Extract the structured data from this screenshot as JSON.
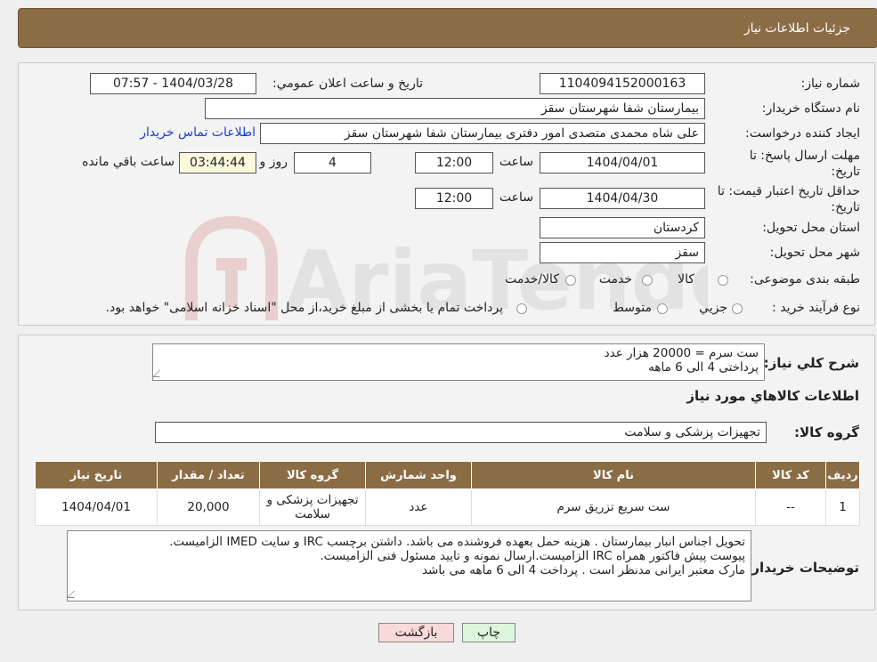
{
  "header": {
    "title": "جزئیات اطلاعات نیاز"
  },
  "form": {
    "need_number_label": "شماره نیاز:",
    "need_number": "1104094152000163",
    "announce_label": "تاریخ و ساعت اعلان عمومي:",
    "announce_value": "1404/03/28 - 07:57",
    "buyer_org_label": "نام دستگاه خريدار:",
    "buyer_org": "بیمارستان شفا شهرستان سقز",
    "creator_label": "ايجاد كننده درخواست:",
    "creator": "علی شاه محمدی متصدی امور دفتری بیمارستان شفا شهرستان سقز",
    "contact_link": "اطلاعات تماس خريدار",
    "deadline_label": "مهلت ارسال پاسخ: تا تاريخ:",
    "deadline_date": "1404/04/01",
    "time_label": "ساعت",
    "deadline_time": "12:00",
    "days_value": "4",
    "days_label": "روز و",
    "remaining_time": "03:44:44",
    "remaining_label": "ساعت باقي مانده",
    "validity_label": "حداقل تاريخ اعتبار قيمت: تا تاريخ:",
    "validity_date": "1404/04/30",
    "validity_time": "12:00",
    "province_label": "استان محل تحويل:",
    "province": "کردستان",
    "city_label": "شهر محل تحويل:",
    "city": "سقز",
    "category_label": "طبقه بندی موضوعی:",
    "category_options": [
      "کالا",
      "خدمت",
      "کالا/خدمت"
    ],
    "process_label": "نوع فرآيند خريد :",
    "process_options": [
      "جزيي",
      "متوسط"
    ],
    "process_note": "پرداخت تمام يا بخشی از مبلغ خريد،از محل \"اسناد خزانه اسلامی\" خواهد بود."
  },
  "summary": {
    "label": "شرح کلي نياز:",
    "line1": "ست سرم = 20000 هزار عدد",
    "line2": "پرداختی 4 الی 6 ماهه",
    "goods_info_title": "اطلاعات کالاهاي مورد نياز",
    "goods_group_label": "گروه کالا:",
    "goods_group": "تجهیزات پزشکی و سلامت"
  },
  "table": {
    "headers": [
      "رديف",
      "کد کالا",
      "نام کالا",
      "واحد شمارش",
      "گروه کالا",
      "تعداد / مقدار",
      "تاريخ نياز"
    ],
    "rows": [
      {
        "row": "1",
        "code": "--",
        "name": "ست سریع تزریق سرم",
        "unit": "عدد",
        "group": "تجهیزات پزشکی و سلامت",
        "qty": "20,000",
        "date": "1404/04/01"
      }
    ]
  },
  "notes": {
    "label": "توضيحات خريدار:",
    "line1": "تحویل اجناس انبار بیمارستان . هزینه حمل بعهده فروشنده می باشد. داشتن برچسب IRC و سایت IMED الزامیست.",
    "line2": "پیوست پیش فاکتور همراه IRC الزامیست.ارسال نمونه و تایید مسئول فنی الزامیست.",
    "line3": "مارک معتبر ایرانی مدنظر است . پرداخت 4 الی 6 ماهه می باشد"
  },
  "buttons": {
    "print": "چاپ",
    "back": "بازگشت"
  },
  "watermark": {
    "text": "AriaTender.neT"
  }
}
